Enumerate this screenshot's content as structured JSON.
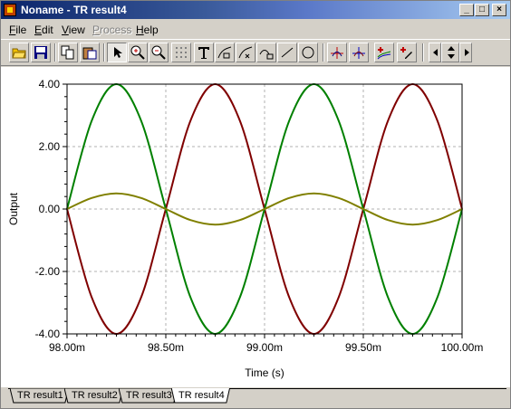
{
  "window": {
    "title": "Noname - TR result4",
    "minimize": "_",
    "maximize": "□",
    "close": "×"
  },
  "menu": [
    {
      "label": "File",
      "underline": "F",
      "rest": "ile",
      "enabled": true
    },
    {
      "label": "Edit",
      "underline": "E",
      "rest": "dit",
      "enabled": true
    },
    {
      "label": "View",
      "underline": "V",
      "rest": "iew",
      "enabled": true
    },
    {
      "label": "Process",
      "underline": "P",
      "rest": "rocess",
      "enabled": false
    },
    {
      "label": "Help",
      "underline": "H",
      "rest": "elp",
      "enabled": true
    }
  ],
  "toolbar": [
    {
      "name": "open-icon"
    },
    {
      "name": "save-icon"
    },
    {
      "name": "copy-icon"
    },
    {
      "name": "paste-icon"
    },
    {
      "name": "pointer-icon",
      "pressed": true
    },
    {
      "name": "zoom-in-icon"
    },
    {
      "name": "zoom-out-icon"
    },
    {
      "name": "grid-icon"
    },
    {
      "name": "text-icon"
    },
    {
      "name": "annotation-icon"
    },
    {
      "name": "annotation-2-icon"
    },
    {
      "name": "annotation-3-icon"
    },
    {
      "name": "line-icon"
    },
    {
      "name": "ellipse-icon"
    },
    {
      "name": "cursor-a-icon"
    },
    {
      "name": "cursor-b-icon"
    },
    {
      "name": "add-curve-icon"
    },
    {
      "name": "picker-icon"
    },
    {
      "name": "scroll-left-icon"
    },
    {
      "name": "pan-icon"
    },
    {
      "name": "scroll-right-icon"
    }
  ],
  "chart_data": {
    "type": "line",
    "xlabel": "Time (s)",
    "ylabel": "Output",
    "xlim": [
      98.0,
      100.0
    ],
    "ylim": [
      -4.0,
      4.0
    ],
    "xticks": [
      "98.00m",
      "98.50m",
      "99.00m",
      "99.50m",
      "100.00m"
    ],
    "xtick_values": [
      98.0,
      98.5,
      99.0,
      99.5,
      100.0
    ],
    "yticks": [
      "4.00",
      "2.00",
      "0.00",
      "-2.00",
      "-4.00"
    ],
    "ytick_values": [
      4,
      2,
      0,
      -2,
      -4
    ],
    "grid": true,
    "series": [
      {
        "color": "#800000",
        "x": [
          98.0,
          98.125,
          98.25,
          98.375,
          98.5,
          98.625,
          98.75,
          98.875,
          99.0,
          99.125,
          99.25,
          99.375,
          99.5,
          99.625,
          99.75,
          99.875,
          100.0
        ],
        "values": [
          0,
          -2.83,
          -4,
          -2.83,
          0,
          2.83,
          4,
          2.83,
          0,
          -2.83,
          -4,
          -2.83,
          0,
          2.83,
          4,
          2.83,
          0
        ]
      },
      {
        "color": "#008000",
        "x": [
          98.0,
          98.125,
          98.25,
          98.375,
          98.5,
          98.625,
          98.75,
          98.875,
          99.0,
          99.125,
          99.25,
          99.375,
          99.5,
          99.625,
          99.75,
          99.875,
          100.0
        ],
        "values": [
          0,
          2.83,
          4,
          2.83,
          0,
          -2.83,
          -4,
          -2.83,
          0,
          2.83,
          4,
          2.83,
          0,
          -2.83,
          -4,
          -2.83,
          0
        ]
      },
      {
        "color": "#808000",
        "x": [
          98.0,
          98.125,
          98.25,
          98.375,
          98.5,
          98.625,
          98.75,
          98.875,
          99.0,
          99.125,
          99.25,
          99.375,
          99.5,
          99.625,
          99.75,
          99.875,
          100.0
        ],
        "values": [
          0,
          0.354,
          0.5,
          0.354,
          0,
          -0.354,
          -0.5,
          -0.354,
          0,
          0.354,
          0.5,
          0.354,
          0,
          -0.354,
          -0.5,
          -0.354,
          0
        ]
      }
    ]
  },
  "tabs": [
    {
      "label": "TR result1",
      "active": false
    },
    {
      "label": "TR result2",
      "active": false
    },
    {
      "label": "TR result3",
      "active": false
    },
    {
      "label": "TR result4",
      "active": true
    }
  ]
}
